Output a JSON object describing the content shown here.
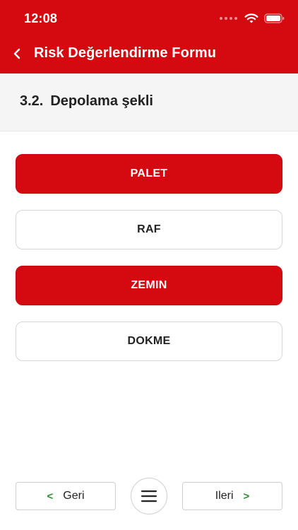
{
  "status_bar": {
    "time": "12:08"
  },
  "nav": {
    "title": "Risk Değerlendirme Formu"
  },
  "question": {
    "number": "3.2.",
    "text": "Depolama şekli"
  },
  "options": [
    {
      "label": "PALET",
      "selected": true
    },
    {
      "label": "RAF",
      "selected": false
    },
    {
      "label": "ZEMIN",
      "selected": true
    },
    {
      "label": "DOKME",
      "selected": false
    }
  ],
  "bottom_nav": {
    "back_label": "Geri",
    "next_label": "Ileri"
  },
  "colors": {
    "primary": "#d50910",
    "chevron": "#2e8b2e",
    "band": "#f5f5f5"
  },
  "icons": {
    "back": "chevron-left-icon",
    "wifi": "wifi-icon",
    "battery": "battery-icon",
    "menu": "hamburger-menu-icon"
  }
}
